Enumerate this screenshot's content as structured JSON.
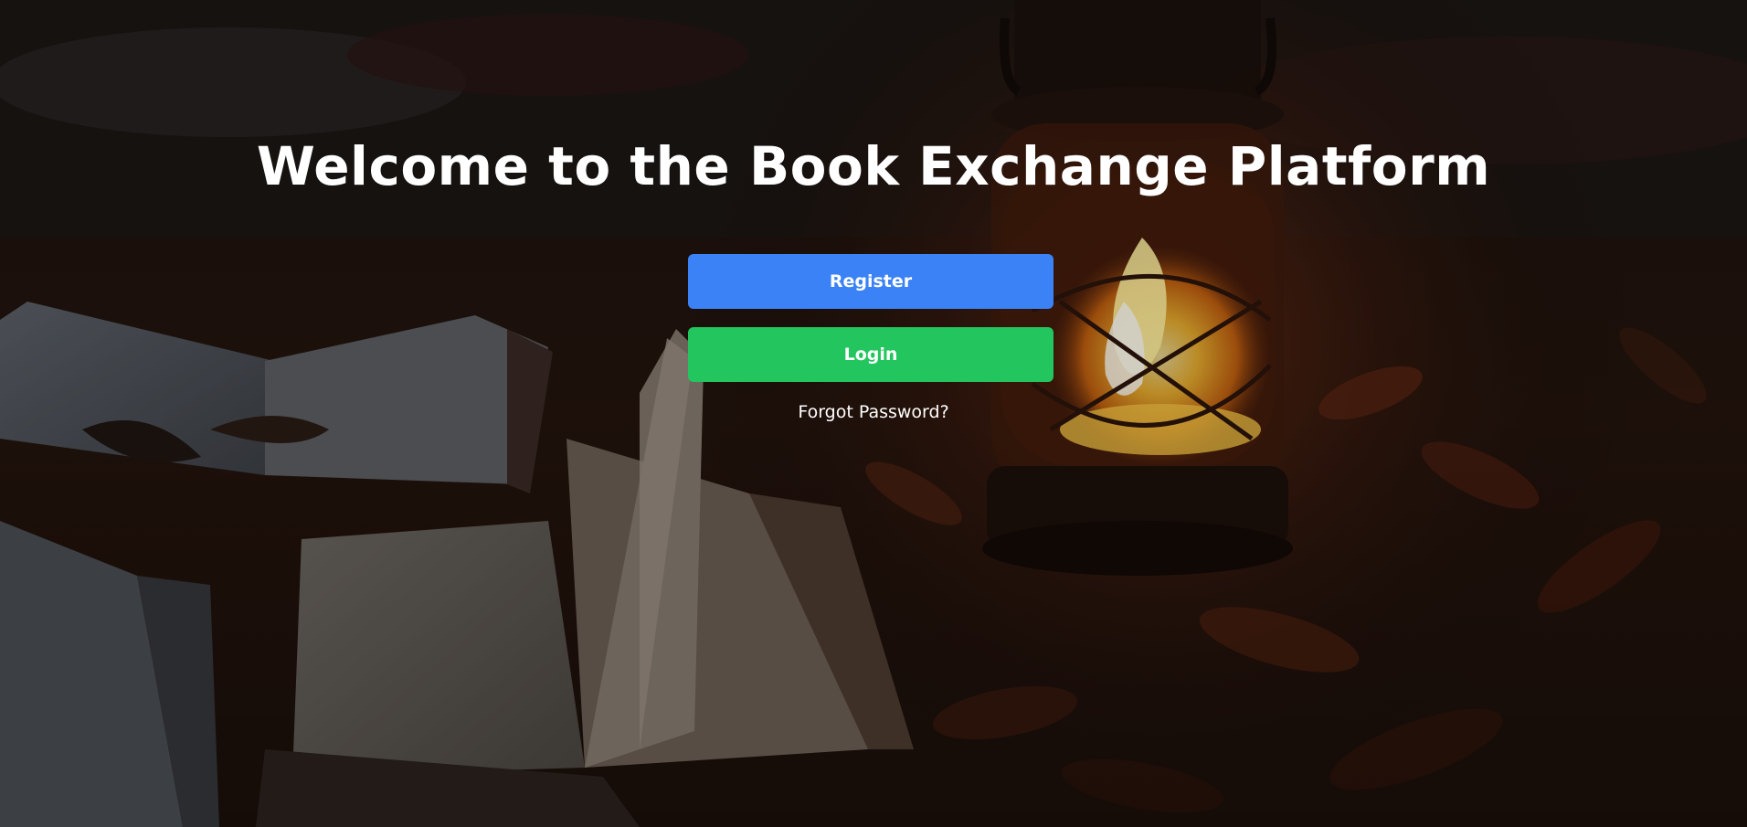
{
  "page": {
    "title": "Welcome to the Book Exchange Platform"
  },
  "actions": {
    "register_label": "Register",
    "login_label": "Login",
    "forgot_label": "Forgot Password?"
  },
  "colors": {
    "register_button": "#3b82f6",
    "login_button": "#22c55e",
    "text": "#ffffff"
  },
  "background": {
    "description_icon": "lantern-and-books-background"
  }
}
